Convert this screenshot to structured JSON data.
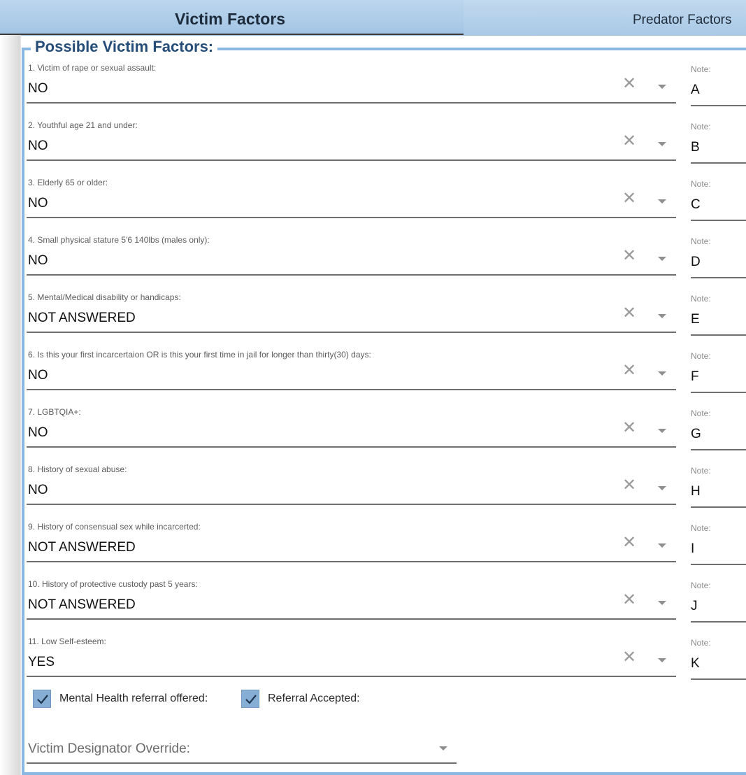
{
  "tabs": [
    {
      "label": "Victim Factors",
      "active": true
    },
    {
      "label": "Predator Factors",
      "active": false
    }
  ],
  "section": {
    "legend": "Possible Victim Factors:"
  },
  "questions": [
    {
      "label": "1. Victim of rape or sexual assault:",
      "value": "NO",
      "note_label": "Note:",
      "note": "A"
    },
    {
      "label": "2. Youthful age 21 and under:",
      "value": "NO",
      "note_label": "Note:",
      "note": "B"
    },
    {
      "label": "3. Elderly 65 or older:",
      "value": "NO",
      "note_label": "Note:",
      "note": "C"
    },
    {
      "label": "4. Small physical stature 5'6 140lbs (males only):",
      "value": "NO",
      "note_label": "Note:",
      "note": "D"
    },
    {
      "label": "5. Mental/Medical disability or handicaps:",
      "value": "NOT ANSWERED",
      "note_label": "Note:",
      "note": "E"
    },
    {
      "label": "6. Is this your first incarcertaion OR is this your first time in jail for longer than thirty(30) days:",
      "value": "NO",
      "note_label": "Note:",
      "note": "F"
    },
    {
      "label": "7. LGBTQIA+:",
      "value": "NO",
      "note_label": "Note:",
      "note": "G"
    },
    {
      "label": "8. History of sexual abuse:",
      "value": "NO",
      "note_label": "Note:",
      "note": "H"
    },
    {
      "label": "9. History of consensual sex while incarcerted:",
      "value": "NOT ANSWERED",
      "note_label": "Note:",
      "note": "I"
    },
    {
      "label": "10. History of protective custody past 5 years:",
      "value": "NOT ANSWERED",
      "note_label": "Note:",
      "note": "J"
    },
    {
      "label": "11. Low Self-esteem:",
      "value": "YES",
      "note_label": "Note:",
      "note": "K"
    }
  ],
  "clear_glyph": "✕",
  "checkboxes": [
    {
      "label": "Mental Health referral offered:",
      "checked": true
    },
    {
      "label": "Referral Accepted:",
      "checked": true
    }
  ],
  "override": {
    "label": "Victim Designator Override:"
  },
  "colors": {
    "accent": "#8ab8e3",
    "tab_bg": "#a9c9e6",
    "checkbox": "#87aed4"
  },
  "icons": {
    "clear": "close-icon",
    "dropdown": "chevron-down-icon",
    "check": "check-icon"
  }
}
